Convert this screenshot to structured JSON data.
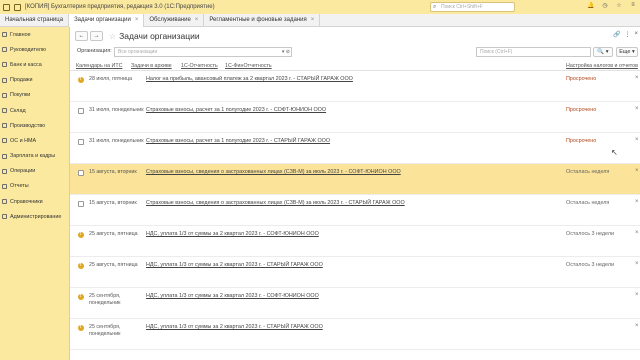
{
  "titlebar": {
    "title": "[КОПИЯ] Бухгалтерия предприятия, редакция 3.0  (1С:Предприятие)",
    "search_placeholder": "Поиск Ctrl+Shift+F",
    "icons": [
      "bell-icon",
      "history-icon",
      "star-icon",
      "menu-icon"
    ]
  },
  "tabs": [
    {
      "label": "Начальная страница"
    },
    {
      "label": "Задачи организации"
    },
    {
      "label": "Обслуживание"
    },
    {
      "label": "Регламентные и фоновые задания"
    }
  ],
  "sidebar": {
    "items": [
      {
        "label": "Главное"
      },
      {
        "label": "Руководителю"
      },
      {
        "label": "Банк и касса"
      },
      {
        "label": "Продажи"
      },
      {
        "label": "Покупки"
      },
      {
        "label": "Склад"
      },
      {
        "label": "Производство"
      },
      {
        "label": "ОС и НМА"
      },
      {
        "label": "Зарплата и кадры"
      },
      {
        "label": "Операции"
      },
      {
        "label": "Отчеты"
      },
      {
        "label": "Справочники"
      },
      {
        "label": "Администрирование"
      }
    ]
  },
  "header": {
    "back": "←",
    "forward": "→",
    "title": "Задачи организации",
    "right_more": "⋮",
    "right_close": "×"
  },
  "toolbar": {
    "org_label": "Организация:",
    "org_placeholder": "Все организации",
    "search_placeholder": "Поиск (Ctrl+F)",
    "search_btn": "🔍 ▾",
    "more_btn": "Еще ▾"
  },
  "links": {
    "calendar": "Календарь на ИТС",
    "archive": "Задачи в архиве",
    "reporting": "1С-Отчетность",
    "finreport": "1С-ФинОтчетность",
    "settings": "Настройка налогов и отчетов"
  },
  "rows": [
    {
      "icon": "alert",
      "date": "28 июля, пятница",
      "task": "Налог на прибыль, авансовый платеж за 2 квартал 2023 г. - СТАРЫЙ ГАРАЖ ООО",
      "status": "Просрочено",
      "status_type": "overdue"
    },
    {
      "icon": "doc",
      "date": "31 июля, понедельник",
      "task": "Страховые взносы, расчет за 1 полугодие 2023 г. - СОФТ-ЮНИОН ООО",
      "status": "Просрочено",
      "status_type": "overdue"
    },
    {
      "icon": "doc",
      "date": "31 июля, понедельник",
      "task": "Страховые взносы, расчет за 1 полугодие 2023 г. - СТАРЫЙ ГАРАЖ ООО",
      "status": "Просрочено",
      "status_type": "overdue"
    },
    {
      "icon": "doc",
      "date": "15 августа, вторник",
      "task": "Страховые взносы, сведения о застрахованных лицах (СЗВ-М) за июль 2023 г. - СОФТ-ЮНИОН ООО",
      "status": "Осталась неделя",
      "status_type": "ok",
      "highlight": true
    },
    {
      "icon": "doc",
      "date": "15 августа, вторник",
      "task": "Страховые взносы, сведения о застрахованных лицах (СЗВ-М) за июль 2023 г. - СТАРЫЙ ГАРАЖ ООО",
      "status": "Осталась неделя",
      "status_type": "ok"
    },
    {
      "icon": "alert",
      "date": "25 августа, пятница",
      "task": "НДС, уплата 1/3 от суммы за 2 квартал 2023 г. - СОФТ-ЮНИОН ООО",
      "status": "Осталось 3 недели",
      "status_type": "ok"
    },
    {
      "icon": "alert",
      "date": "25 августа, пятница",
      "task": "НДС, уплата 1/3 от суммы за 2 квартал 2023 г. - СТАРЫЙ ГАРАЖ ООО",
      "status": "Осталось 3 недели",
      "status_type": "ok"
    },
    {
      "icon": "alert",
      "date": "25 сентября, понедельник",
      "task": "НДС, уплата 1/3 от суммы за 2 квартал 2023 г. - СОФТ-ЮНИОН ООО",
      "status": "",
      "status_type": "ok"
    },
    {
      "icon": "alert",
      "date": "25 сентября, понедельник",
      "task": "НДС, уплата 1/3 от суммы за 2 квартал 2023 г. - СТАРЫЙ ГАРАЖ ООО",
      "status": "",
      "status_type": "ok"
    }
  ]
}
